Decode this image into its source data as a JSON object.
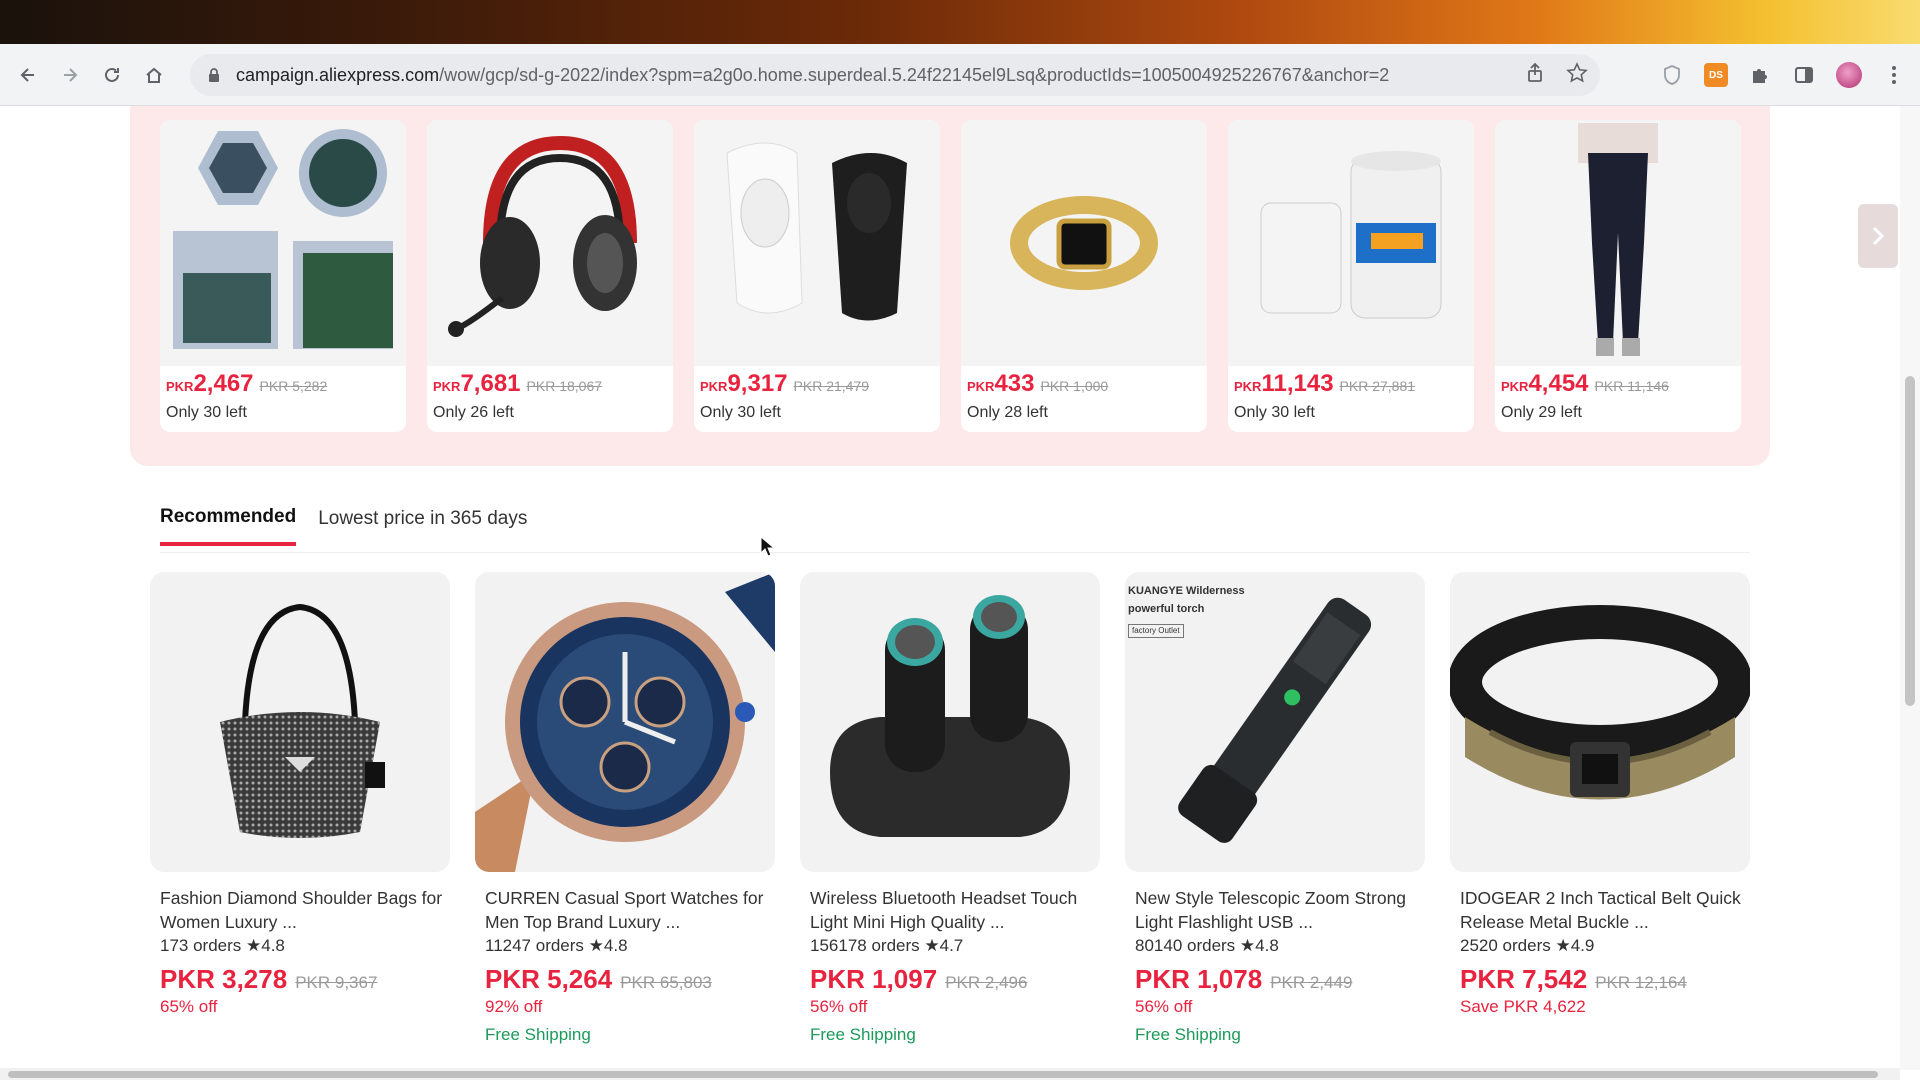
{
  "browser": {
    "url_host": "campaign.aliexpress.com",
    "url_path": "/wow/gcp/sd-g-2022/index?spm=a2g0o.home.superdeal.5.24f22145el9Lsq&productIds=1005004925226767&anchor=2",
    "ext_badge": "DS"
  },
  "deals": [
    {
      "currency": "PKR",
      "price": "2,467",
      "old_price": "PKR 5,282",
      "stock": "Only 30 left"
    },
    {
      "currency": "PKR",
      "price": "7,681",
      "old_price": "PKR 18,067",
      "stock": "Only 26 left"
    },
    {
      "currency": "PKR",
      "price": "9,317",
      "old_price": "PKR 21,479",
      "stock": "Only 30 left"
    },
    {
      "currency": "PKR",
      "price": "433",
      "old_price": "PKR 1,000",
      "stock": "Only 28 left"
    },
    {
      "currency": "PKR",
      "price": "11,143",
      "old_price": "PKR 27,881",
      "stock": "Only 30 left"
    },
    {
      "currency": "PKR",
      "price": "4,454",
      "old_price": "PKR 11,146",
      "stock": "Only 29 left"
    }
  ],
  "tabs": {
    "recommended": "Recommended",
    "lowest": "Lowest price in 365 days"
  },
  "products": [
    {
      "title": "Fashion Diamond Shoulder Bags for Women Luxury ...",
      "orders": "173 orders",
      "rating": "★4.8",
      "price": "PKR 3,278",
      "old_price": "PKR 9,367",
      "discount": "65% off",
      "shipping": ""
    },
    {
      "title": "CURREN Casual Sport Watches for Men Top Brand Luxury ...",
      "orders": "11247 orders",
      "rating": "★4.8",
      "price": "PKR 5,264",
      "old_price": "PKR 65,803",
      "discount": "92% off",
      "shipping": "Free Shipping"
    },
    {
      "title": "Wireless Bluetooth Headset Touch Light Mini High Quality ...",
      "orders": "156178 orders",
      "rating": "★4.7",
      "price": "PKR 1,097",
      "old_price": "PKR 2,496",
      "discount": "56% off",
      "shipping": "Free Shipping"
    },
    {
      "title": "New Style Telescopic Zoom Strong Light Flashlight USB ...",
      "orders": "80140 orders",
      "rating": "★4.8",
      "price": "PKR 1,078",
      "old_price": "PKR 2,449",
      "discount": "56% off",
      "shipping": "Free Shipping"
    },
    {
      "title": "IDOGEAR 2 Inch Tactical Belt Quick Release Metal Buckle ...",
      "orders": "2520 orders",
      "rating": "★4.9",
      "price": "PKR 7,542",
      "old_price": "PKR 12,164",
      "discount": "Save PKR 4,622",
      "shipping": ""
    }
  ],
  "flashlight_overlay": {
    "line1": "KUANGYE Wilderness",
    "line2": "powerful torch",
    "tag": "factory Outlet"
  },
  "colors": {
    "accent": "#e8233f",
    "panel_bg": "#fde8ea",
    "shipping": "#1b9a5a"
  }
}
